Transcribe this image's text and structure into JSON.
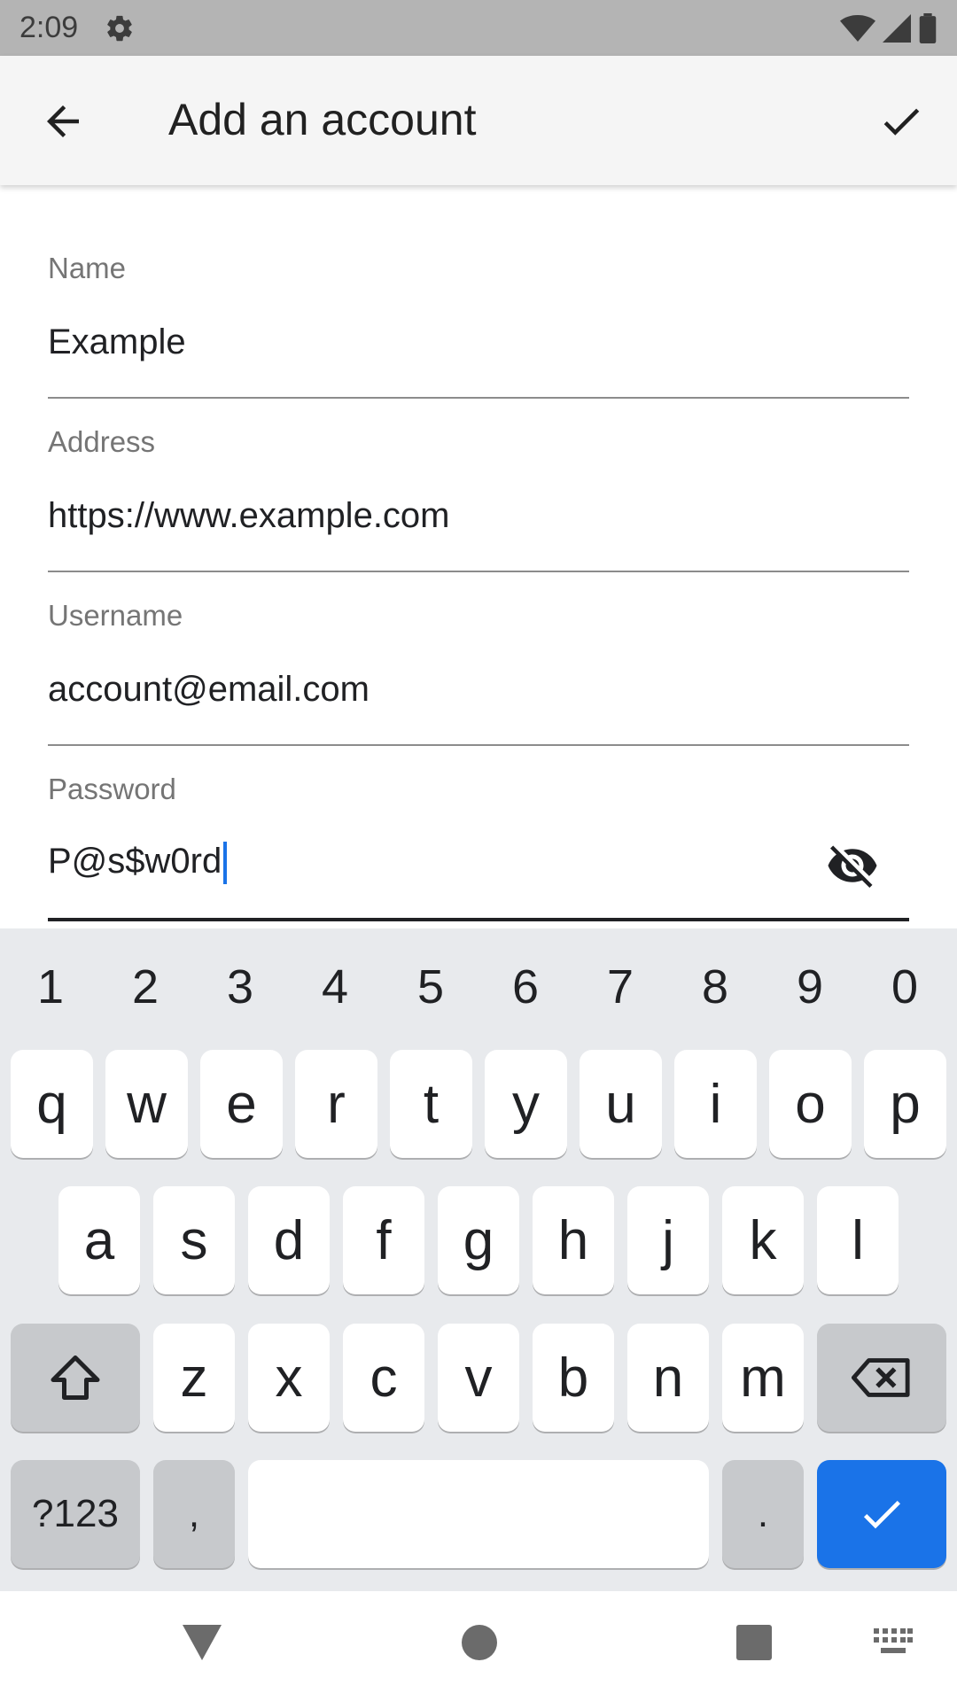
{
  "status_bar": {
    "time": "2:09",
    "icons": [
      "gear-icon",
      "wifi-icon",
      "signal-icon",
      "battery-icon"
    ]
  },
  "app_bar": {
    "title": "Add an account",
    "back_icon": "arrow-back-icon",
    "confirm_icon": "check-icon"
  },
  "form": {
    "name": {
      "label": "Name",
      "value": "Example"
    },
    "address": {
      "label": "Address",
      "value": "https://www.example.com"
    },
    "username": {
      "label": "Username",
      "value": "account@email.com"
    },
    "password": {
      "label": "Password",
      "value": "P@s$w0rd",
      "toggle_icon": "visibility-off-icon"
    }
  },
  "keyboard": {
    "numbers": [
      "1",
      "2",
      "3",
      "4",
      "5",
      "6",
      "7",
      "8",
      "9",
      "0"
    ],
    "row1": [
      "q",
      "w",
      "e",
      "r",
      "t",
      "y",
      "u",
      "i",
      "o",
      "p"
    ],
    "row2": [
      "a",
      "s",
      "d",
      "f",
      "g",
      "h",
      "j",
      "k",
      "l"
    ],
    "row3": [
      "z",
      "x",
      "c",
      "v",
      "b",
      "n",
      "m"
    ],
    "symbols_label": "?123",
    "comma": ",",
    "period": ".",
    "accent_color": "#1a73e8"
  },
  "nav_bar": {
    "icons": [
      "nav-back-icon",
      "nav-home-icon",
      "nav-recents-icon",
      "keyboard-switch-icon"
    ]
  }
}
